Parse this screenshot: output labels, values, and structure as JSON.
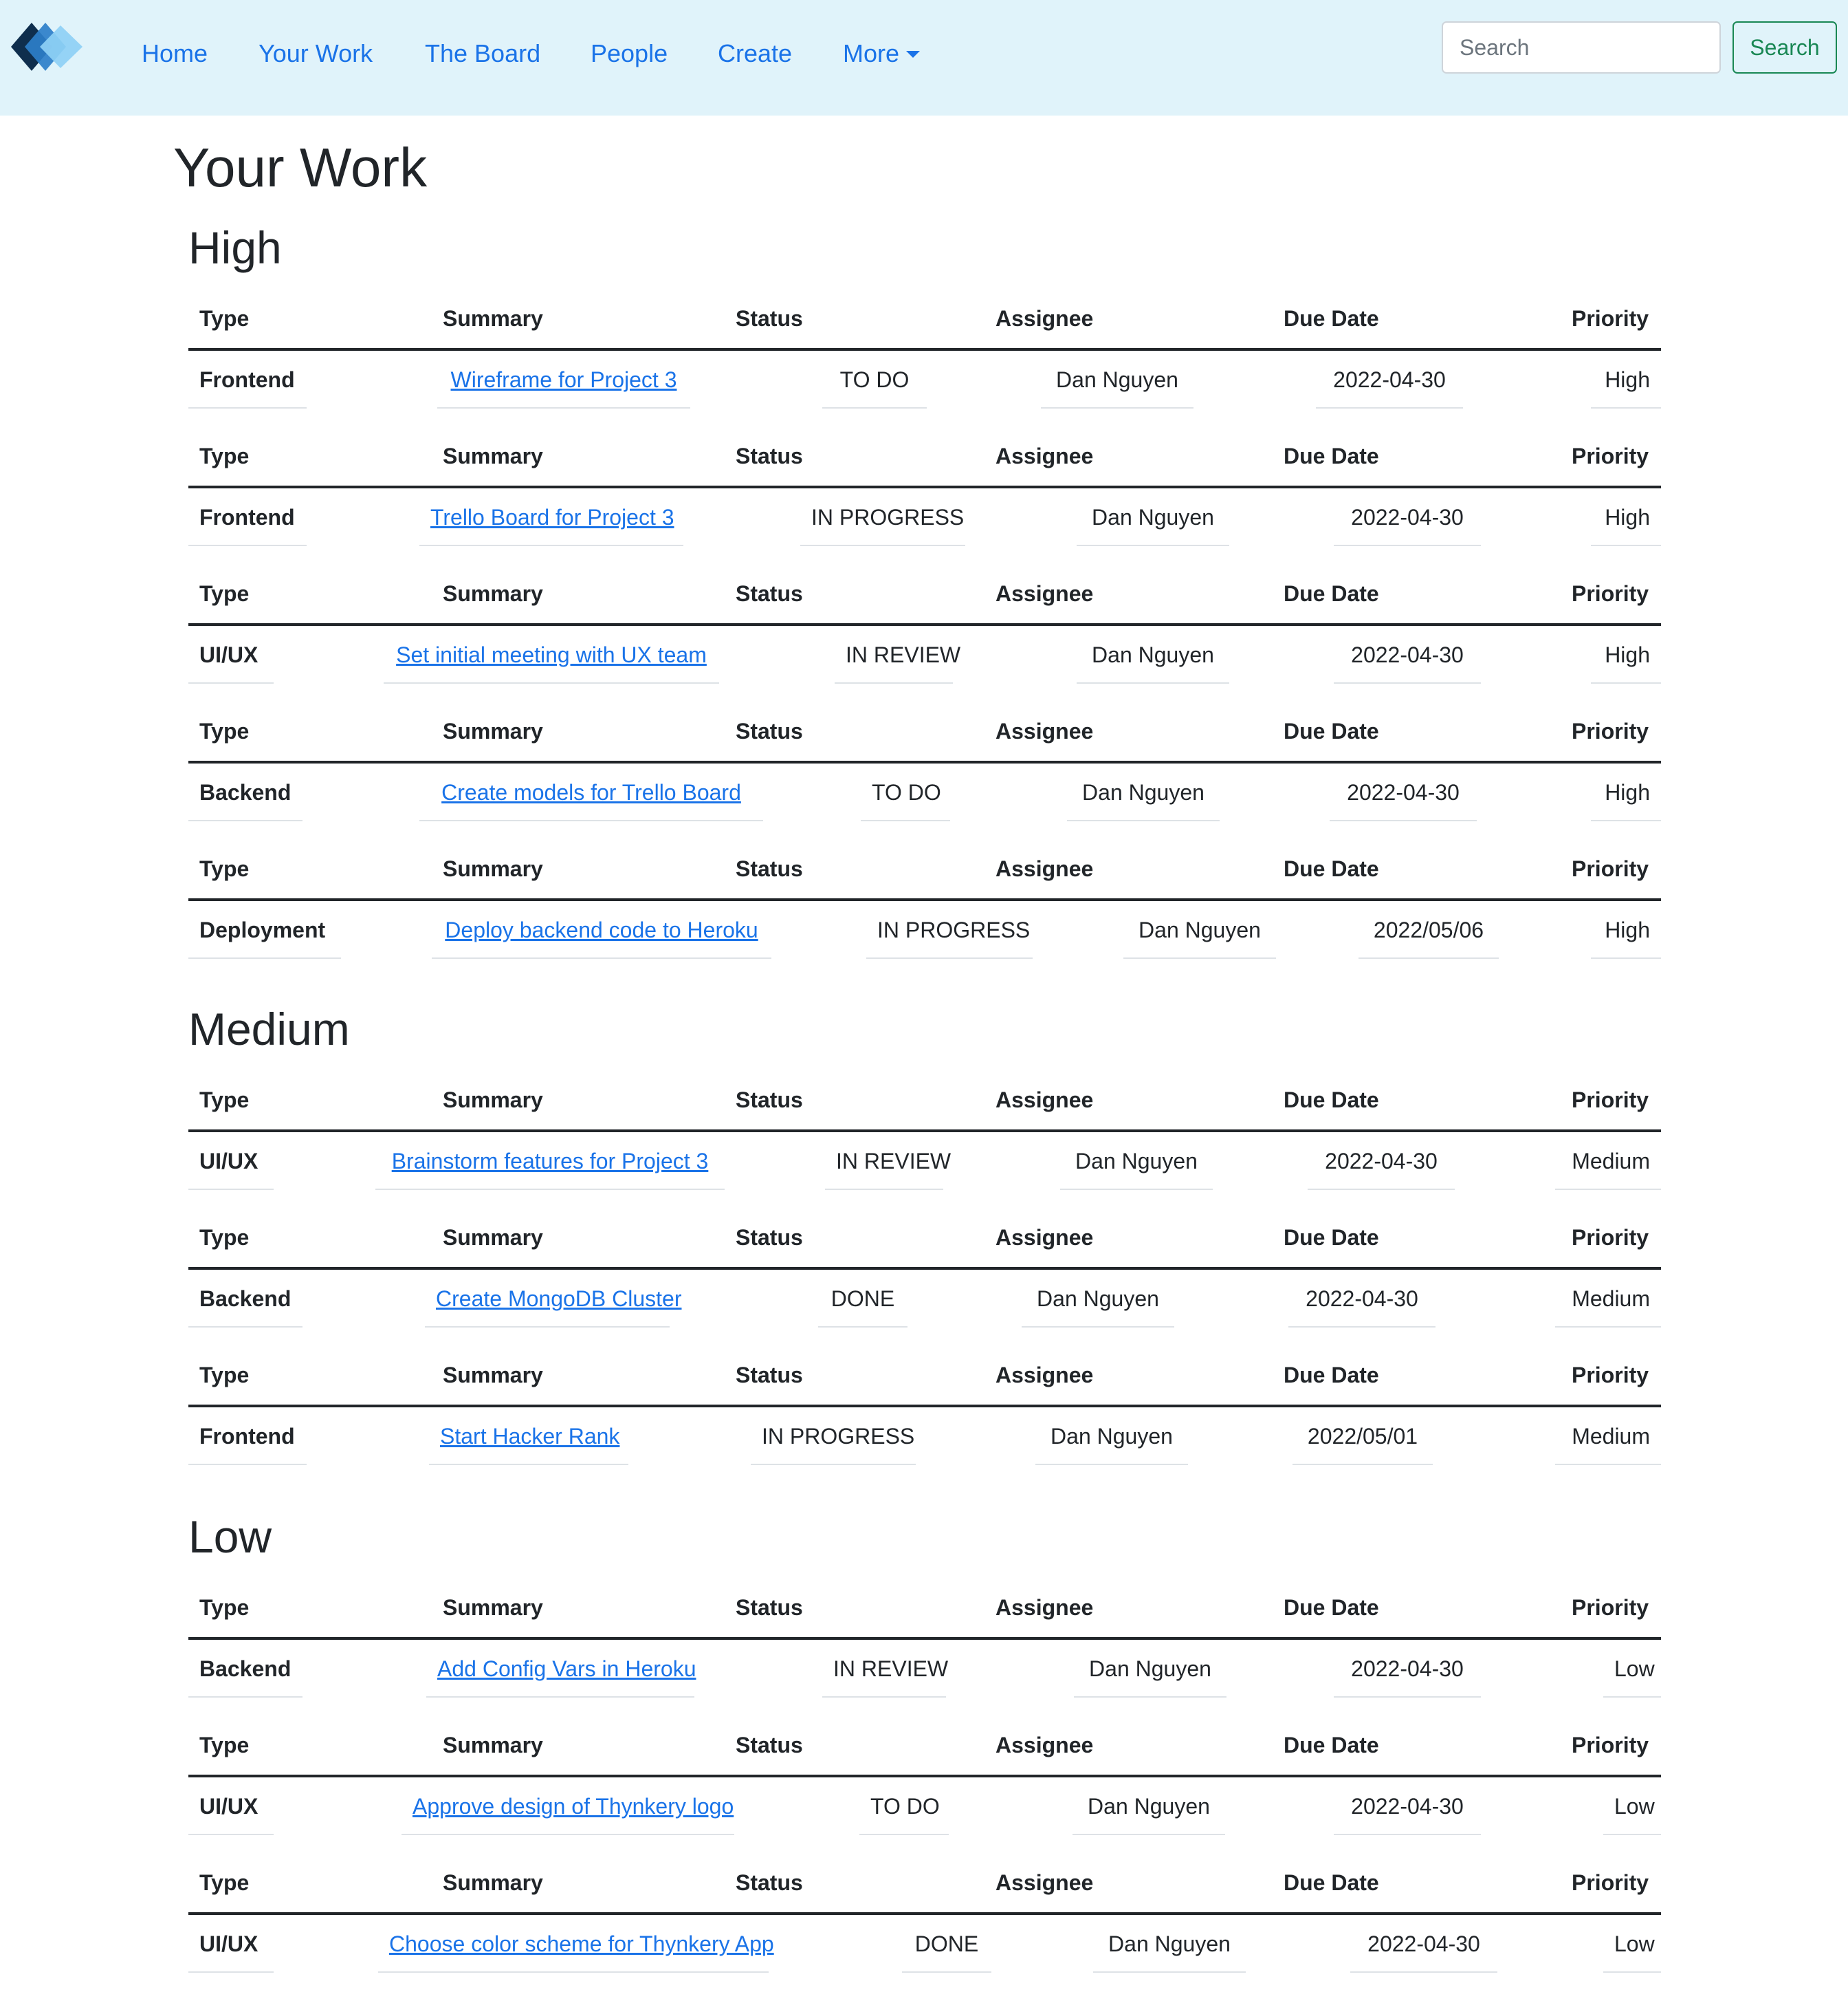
{
  "nav": {
    "logo": "logo",
    "links": [
      "Home",
      "Your Work",
      "The Board",
      "People",
      "Create"
    ],
    "more": "More",
    "search_placeholder": "Search",
    "search_button": "Search",
    "link_color": "#1a73e8",
    "background": "#e0f3fa"
  },
  "page_title": "Your Work",
  "headers": {
    "type": "Type",
    "summary": "Summary",
    "status": "Status",
    "assignee": "Assignee",
    "due": "Due Date",
    "priority": "Priority"
  },
  "sections": [
    {
      "name": "High",
      "tasks": [
        {
          "type": "Frontend",
          "summary": "Wireframe for Project 3",
          "status": "TO DO",
          "assignee": "Dan Nguyen",
          "due": "2022-04-30",
          "priority": "High"
        },
        {
          "type": "Frontend",
          "summary": "Trello Board for Project 3",
          "status": "IN PROGRESS",
          "assignee": "Dan Nguyen",
          "due": "2022-04-30",
          "priority": "High"
        },
        {
          "type": "UI/UX",
          "summary": "Set initial meeting with UX team",
          "status": "IN REVIEW",
          "assignee": "Dan Nguyen",
          "due": "2022-04-30",
          "priority": "High"
        },
        {
          "type": "Backend",
          "summary": "Create models for Trello Board",
          "status": "TO DO",
          "assignee": "Dan Nguyen",
          "due": "2022-04-30",
          "priority": "High"
        },
        {
          "type": "Deployment",
          "summary": "Deploy backend code to Heroku",
          "status": "IN PROGRESS",
          "assignee": "Dan Nguyen",
          "due": "2022/05/06",
          "priority": "High"
        }
      ]
    },
    {
      "name": "Medium",
      "tasks": [
        {
          "type": "UI/UX",
          "summary": "Brainstorm features for Project 3",
          "status": "IN REVIEW",
          "assignee": "Dan Nguyen",
          "due": "2022-04-30",
          "priority": "Medium"
        },
        {
          "type": "Backend",
          "summary": "Create MongoDB Cluster",
          "status": "DONE",
          "assignee": "Dan Nguyen",
          "due": "2022-04-30",
          "priority": "Medium"
        },
        {
          "type": "Frontend",
          "summary": "Start Hacker Rank",
          "status": "IN PROGRESS",
          "assignee": "Dan Nguyen",
          "due": "2022/05/01",
          "priority": "Medium"
        }
      ]
    },
    {
      "name": "Low",
      "tasks": [
        {
          "type": "Backend",
          "summary": "Add Config Vars in Heroku",
          "status": "IN REVIEW",
          "assignee": "Dan Nguyen",
          "due": "2022-04-30",
          "priority": "Low"
        },
        {
          "type": "UI/UX",
          "summary": "Approve design of Thynkery logo",
          "status": "TO DO",
          "assignee": "Dan Nguyen",
          "due": "2022-04-30",
          "priority": "Low"
        },
        {
          "type": "UI/UX",
          "summary": "Choose color scheme for Thynkery App",
          "status": "DONE",
          "assignee": "Dan Nguyen",
          "due": "2022-04-30",
          "priority": "Low"
        }
      ]
    }
  ]
}
